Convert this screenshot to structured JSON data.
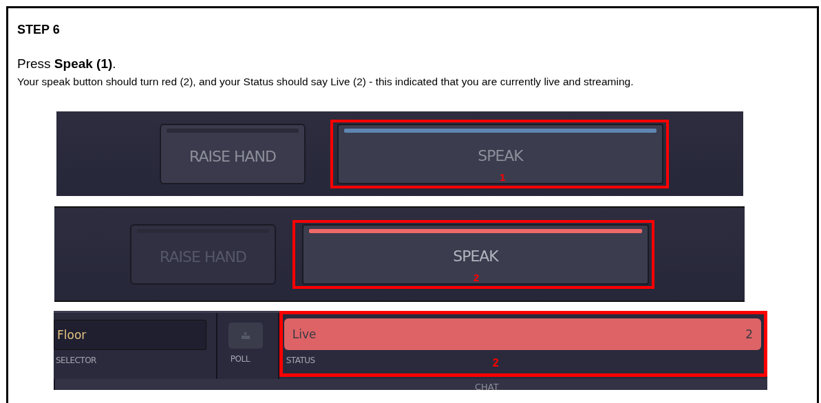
{
  "step_title": "STEP 6",
  "instruction": "Press **Speak (1)**.",
  "description": "Your speak button should turn red (2), and your Status should say Live (2) - this indicated that you are currently live and streaming.",
  "panels": [
    {
      "kind": "buttons",
      "raise_hand": {
        "label": "RAISE HAND",
        "disabled": false
      },
      "speak": {
        "label": "SPEAK",
        "live": false
      },
      "callout": "1"
    },
    {
      "kind": "buttons",
      "raise_hand": {
        "label": "RAISE HAND",
        "disabled": true
      },
      "speak": {
        "label": "SPEAK",
        "live": true
      },
      "callout": "2"
    },
    {
      "kind": "status",
      "selector": {
        "value": "Floor",
        "label": "SELECTOR"
      },
      "poll": {
        "label": "POLL"
      },
      "status": {
        "value": "Live",
        "count": "2",
        "label": "STATUS",
        "live": true
      },
      "callout": "2",
      "chat": {
        "label": "CHAT"
      }
    }
  ]
}
